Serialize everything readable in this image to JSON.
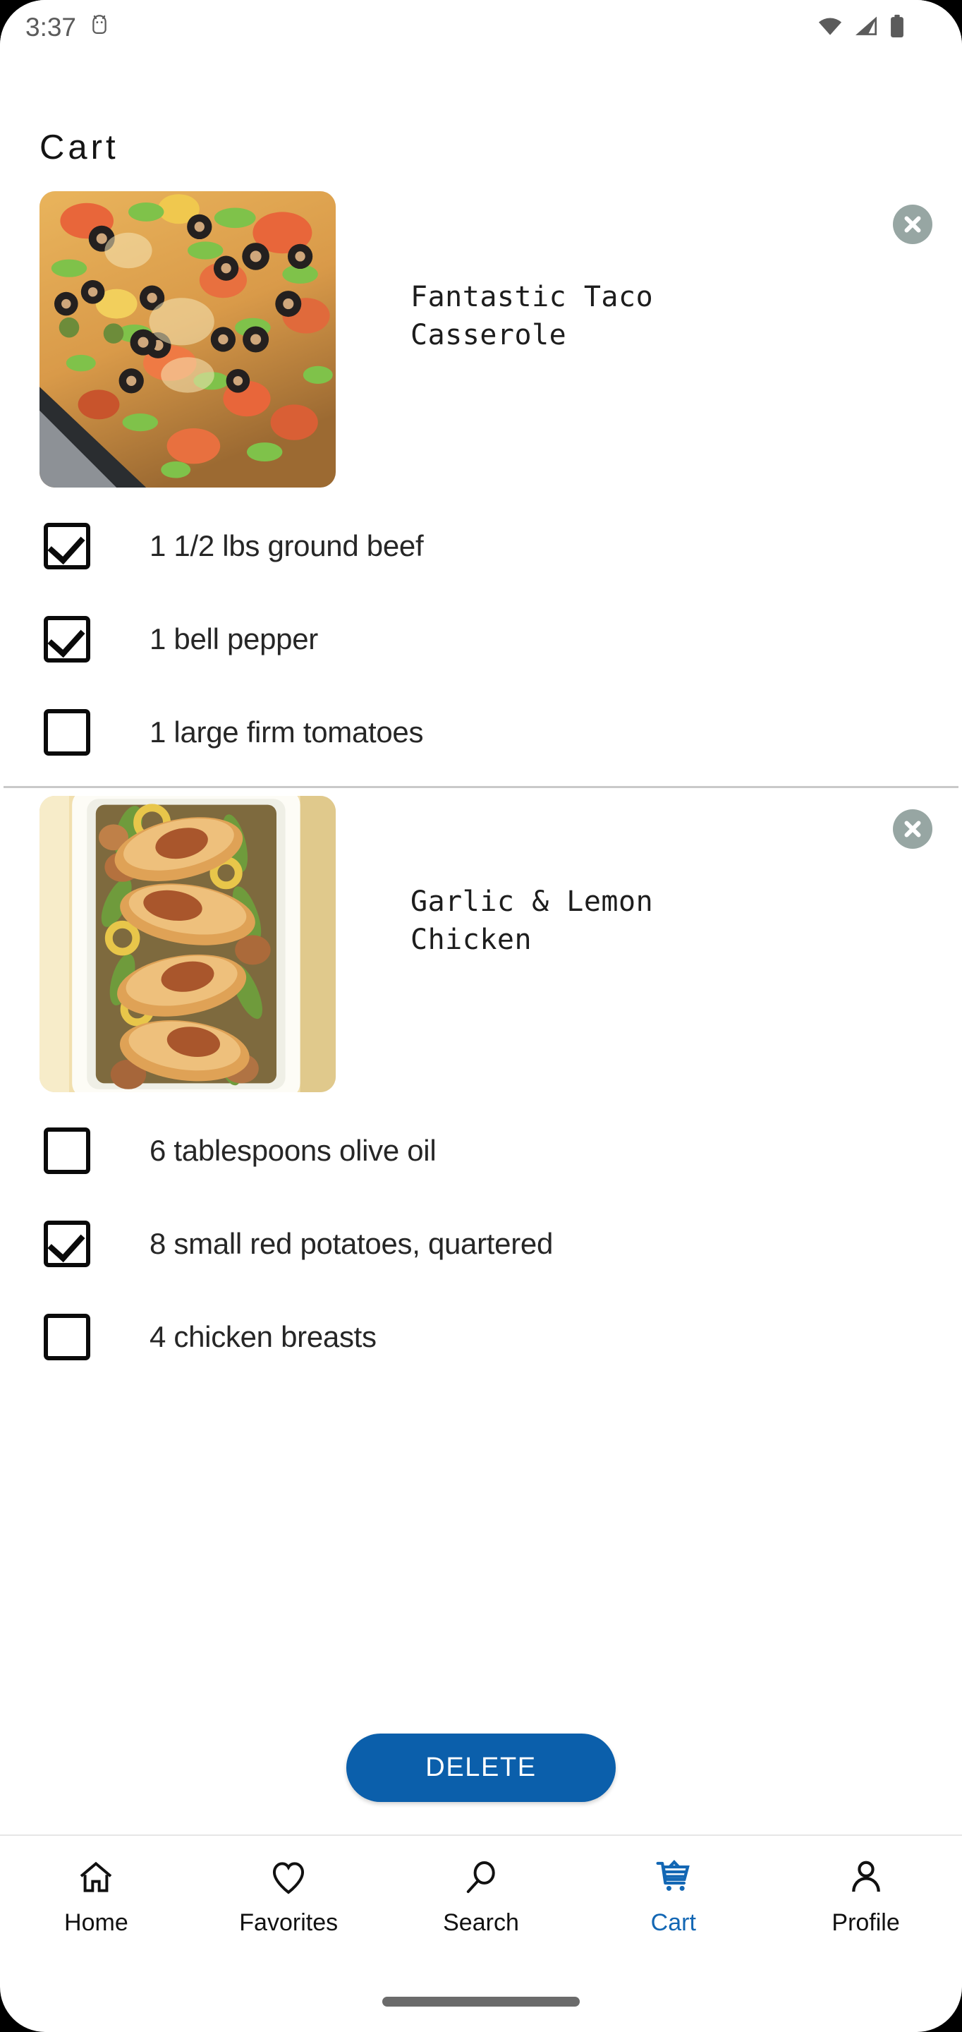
{
  "status_bar": {
    "time": "3:37",
    "icons": [
      "android-debug-icon",
      "wifi-icon",
      "cellular-signal-icon",
      "battery-icon"
    ]
  },
  "header": {
    "title": "Cart"
  },
  "recipes": [
    {
      "title": "Fantastic Taco\nCasserole",
      "image_alt": "taco-casserole-photo",
      "remove_label": "Remove",
      "ingredients": [
        {
          "label": "1 1/2 lbs ground beef",
          "checked": true
        },
        {
          "label": "1 bell pepper",
          "checked": true
        },
        {
          "label": "1 large firm tomatoes",
          "checked": false
        }
      ]
    },
    {
      "title": "Garlic & Lemon\nChicken",
      "image_alt": "garlic-lemon-chicken-photo",
      "remove_label": "Remove",
      "ingredients": [
        {
          "label": "6 tablespoons olive oil",
          "checked": false
        },
        {
          "label": "8 small red potatoes, quartered",
          "checked": true
        },
        {
          "label": "4 chicken breasts",
          "checked": false
        }
      ]
    }
  ],
  "actions": {
    "delete_label": "DELETE"
  },
  "bottom_nav": {
    "active": "Cart",
    "items": [
      {
        "label": "Home",
        "icon": "home-icon"
      },
      {
        "label": "Favorites",
        "icon": "heart-icon"
      },
      {
        "label": "Search",
        "icon": "search-icon"
      },
      {
        "label": "Cart",
        "icon": "shopping-cart-icon"
      },
      {
        "label": "Profile",
        "icon": "person-icon"
      }
    ]
  },
  "colors": {
    "accent": "#1367b4",
    "delete_button": "#0b5fab",
    "close_button": "#97a6a3",
    "divider": "#c9c9c9",
    "text": "#262626"
  }
}
